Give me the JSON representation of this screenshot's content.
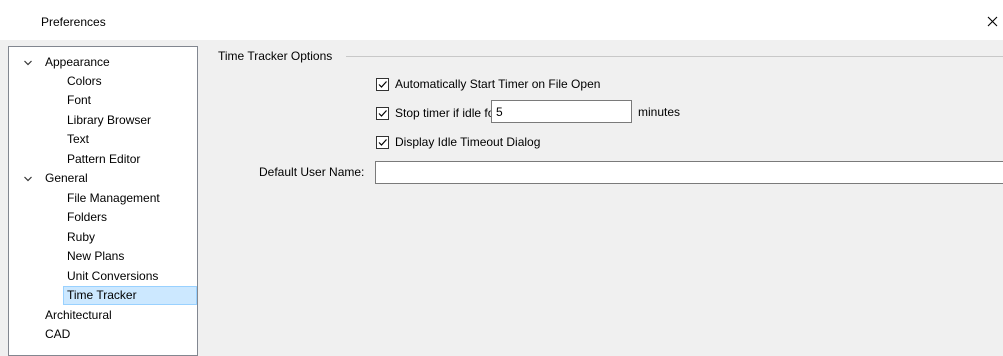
{
  "window": {
    "title": "Preferences",
    "close_icon": "close-icon"
  },
  "tree": {
    "items": [
      {
        "label": "Appearance",
        "level": 0,
        "expanded": true
      },
      {
        "label": "Colors",
        "level": 1
      },
      {
        "label": "Font",
        "level": 1
      },
      {
        "label": "Library Browser",
        "level": 1
      },
      {
        "label": "Text",
        "level": 1
      },
      {
        "label": "Pattern Editor",
        "level": 1
      },
      {
        "label": "General",
        "level": 0,
        "expanded": true
      },
      {
        "label": "File Management",
        "level": 1
      },
      {
        "label": "Folders",
        "level": 1
      },
      {
        "label": "Ruby",
        "level": 1
      },
      {
        "label": "New Plans",
        "level": 1
      },
      {
        "label": "Unit Conversions",
        "level": 1
      },
      {
        "label": "Time Tracker",
        "level": 1,
        "selected": true
      },
      {
        "label": "Architectural",
        "level": 0
      },
      {
        "label": "CAD",
        "level": 0
      }
    ],
    "selected_color": "#cce8ff"
  },
  "panel": {
    "group_title": "Time Tracker Options",
    "auto_start": {
      "label": "Automatically Start Timer on File Open",
      "checked": true
    },
    "stop_idle": {
      "label": "Stop timer if idle for",
      "checked": true,
      "value": "5",
      "unit": "minutes"
    },
    "idle_dialog": {
      "label": "Display Idle Timeout Dialog",
      "checked": true
    },
    "user_name": {
      "label": "Default User Name:",
      "value": ""
    }
  }
}
